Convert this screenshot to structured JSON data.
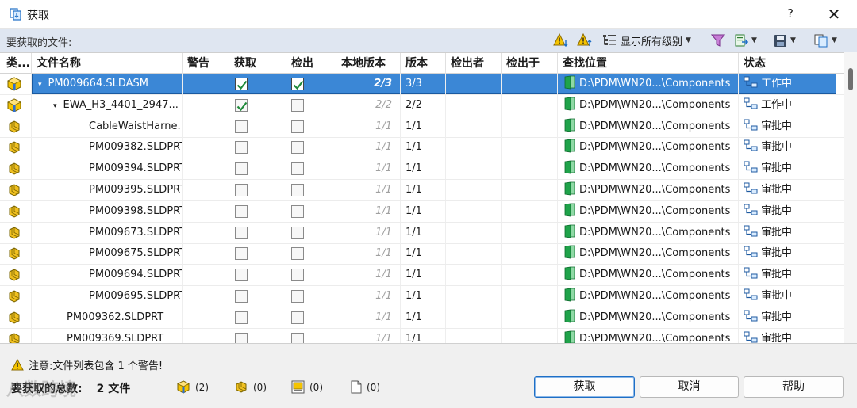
{
  "window": {
    "title": "获取",
    "help": "?",
    "close": "✕"
  },
  "toolbar": {
    "label": "要获取的文件:",
    "levels_label": "显示所有级别"
  },
  "columns": [
    "类...",
    "文件名称",
    "警告",
    "获取",
    "检出",
    "本地版本",
    "版本",
    "检出者",
    "检出于",
    "查找位置",
    "状态"
  ],
  "rows": [
    {
      "type": "assembly",
      "name": "PM009664.SLDASM",
      "indent": 0,
      "expand": "▾",
      "warning": "",
      "get": true,
      "checkout": true,
      "local": "2/3",
      "version": "3/3",
      "checked_out_by": "",
      "checked_out_in": "",
      "location": "D:\\PDM\\WN20...\\Components",
      "status": "工作中",
      "selected": true
    },
    {
      "type": "assembly",
      "name": "EWA_H3_4401_2947...",
      "indent": 1,
      "expand": "▾",
      "warning": "",
      "get": true,
      "checkout": false,
      "local": "2/2",
      "version": "2/2",
      "checked_out_by": "",
      "checked_out_in": "",
      "location": "D:\\PDM\\WN20...\\Components",
      "status": "工作中",
      "selected": false
    },
    {
      "type": "part",
      "name": "CableWaistHarne...",
      "indent": 2,
      "expand": "",
      "warning": "",
      "get": false,
      "checkout": false,
      "local": "1/1",
      "version": "1/1",
      "checked_out_by": "",
      "checked_out_in": "",
      "location": "D:\\PDM\\WN20...\\Components",
      "status": "审批中",
      "selected": false
    },
    {
      "type": "part",
      "name": "PM009382.SLDPRT",
      "indent": 2,
      "expand": "",
      "warning": "",
      "get": false,
      "checkout": false,
      "local": "1/1",
      "version": "1/1",
      "checked_out_by": "",
      "checked_out_in": "",
      "location": "D:\\PDM\\WN20...\\Components",
      "status": "审批中",
      "selected": false
    },
    {
      "type": "part",
      "name": "PM009394.SLDPRT",
      "indent": 2,
      "expand": "",
      "warning": "",
      "get": false,
      "checkout": false,
      "local": "1/1",
      "version": "1/1",
      "checked_out_by": "",
      "checked_out_in": "",
      "location": "D:\\PDM\\WN20...\\Components",
      "status": "审批中",
      "selected": false
    },
    {
      "type": "part",
      "name": "PM009395.SLDPRT",
      "indent": 2,
      "expand": "",
      "warning": "",
      "get": false,
      "checkout": false,
      "local": "1/1",
      "version": "1/1",
      "checked_out_by": "",
      "checked_out_in": "",
      "location": "D:\\PDM\\WN20...\\Components",
      "status": "审批中",
      "selected": false
    },
    {
      "type": "part",
      "name": "PM009398.SLDPRT",
      "indent": 2,
      "expand": "",
      "warning": "",
      "get": false,
      "checkout": false,
      "local": "1/1",
      "version": "1/1",
      "checked_out_by": "",
      "checked_out_in": "",
      "location": "D:\\PDM\\WN20...\\Components",
      "status": "审批中",
      "selected": false
    },
    {
      "type": "part",
      "name": "PM009673.SLDPRT",
      "indent": 2,
      "expand": "",
      "warning": "",
      "get": false,
      "checkout": false,
      "local": "1/1",
      "version": "1/1",
      "checked_out_by": "",
      "checked_out_in": "",
      "location": "D:\\PDM\\WN20...\\Components",
      "status": "审批中",
      "selected": false
    },
    {
      "type": "part",
      "name": "PM009675.SLDPRT",
      "indent": 2,
      "expand": "",
      "warning": "",
      "get": false,
      "checkout": false,
      "local": "1/1",
      "version": "1/1",
      "checked_out_by": "",
      "checked_out_in": "",
      "location": "D:\\PDM\\WN20...\\Components",
      "status": "审批中",
      "selected": false
    },
    {
      "type": "part",
      "name": "PM009694.SLDPRT",
      "indent": 2,
      "expand": "",
      "warning": "",
      "get": false,
      "checkout": false,
      "local": "1/1",
      "version": "1/1",
      "checked_out_by": "",
      "checked_out_in": "",
      "location": "D:\\PDM\\WN20...\\Components",
      "status": "审批中",
      "selected": false
    },
    {
      "type": "part",
      "name": "PM009695.SLDPRT",
      "indent": 2,
      "expand": "",
      "warning": "",
      "get": false,
      "checkout": false,
      "local": "1/1",
      "version": "1/1",
      "checked_out_by": "",
      "checked_out_in": "",
      "location": "D:\\PDM\\WN20...\\Components",
      "status": "审批中",
      "selected": false
    },
    {
      "type": "part",
      "name": "PM009362.SLDPRT",
      "indent": 1,
      "expand": "",
      "warning": "",
      "get": false,
      "checkout": false,
      "local": "1/1",
      "version": "1/1",
      "checked_out_by": "",
      "checked_out_in": "",
      "location": "D:\\PDM\\WN20...\\Components",
      "status": "审批中",
      "selected": false
    },
    {
      "type": "part",
      "name": "PM009369.SLDPRT",
      "indent": 1,
      "expand": "",
      "warning": "",
      "get": false,
      "checkout": false,
      "local": "1/1",
      "version": "1/1",
      "checked_out_by": "",
      "checked_out_in": "",
      "location": "D:\\PDM\\WN20...\\Components",
      "status": "审批中",
      "selected": false
    }
  ],
  "footer": {
    "warning_text": "注意:文件列表包含 1 个警告!",
    "total_label": "要获取的总数:",
    "total_count": "2 文件",
    "stat_assemblies": "(2)",
    "stat_parts": "(0)",
    "stat_drawings": "(0)",
    "stat_other": "(0)",
    "btn_get": "获取",
    "btn_cancel": "取消",
    "btn_help": "帮助"
  },
  "watermark": "八数跨境",
  "colors": {
    "selection": "#3b87d6",
    "check": "#1f8a3a",
    "folder": "#1fa34a",
    "assembly": "#e8b800",
    "toolbar_bg": "#dfe6f1"
  }
}
